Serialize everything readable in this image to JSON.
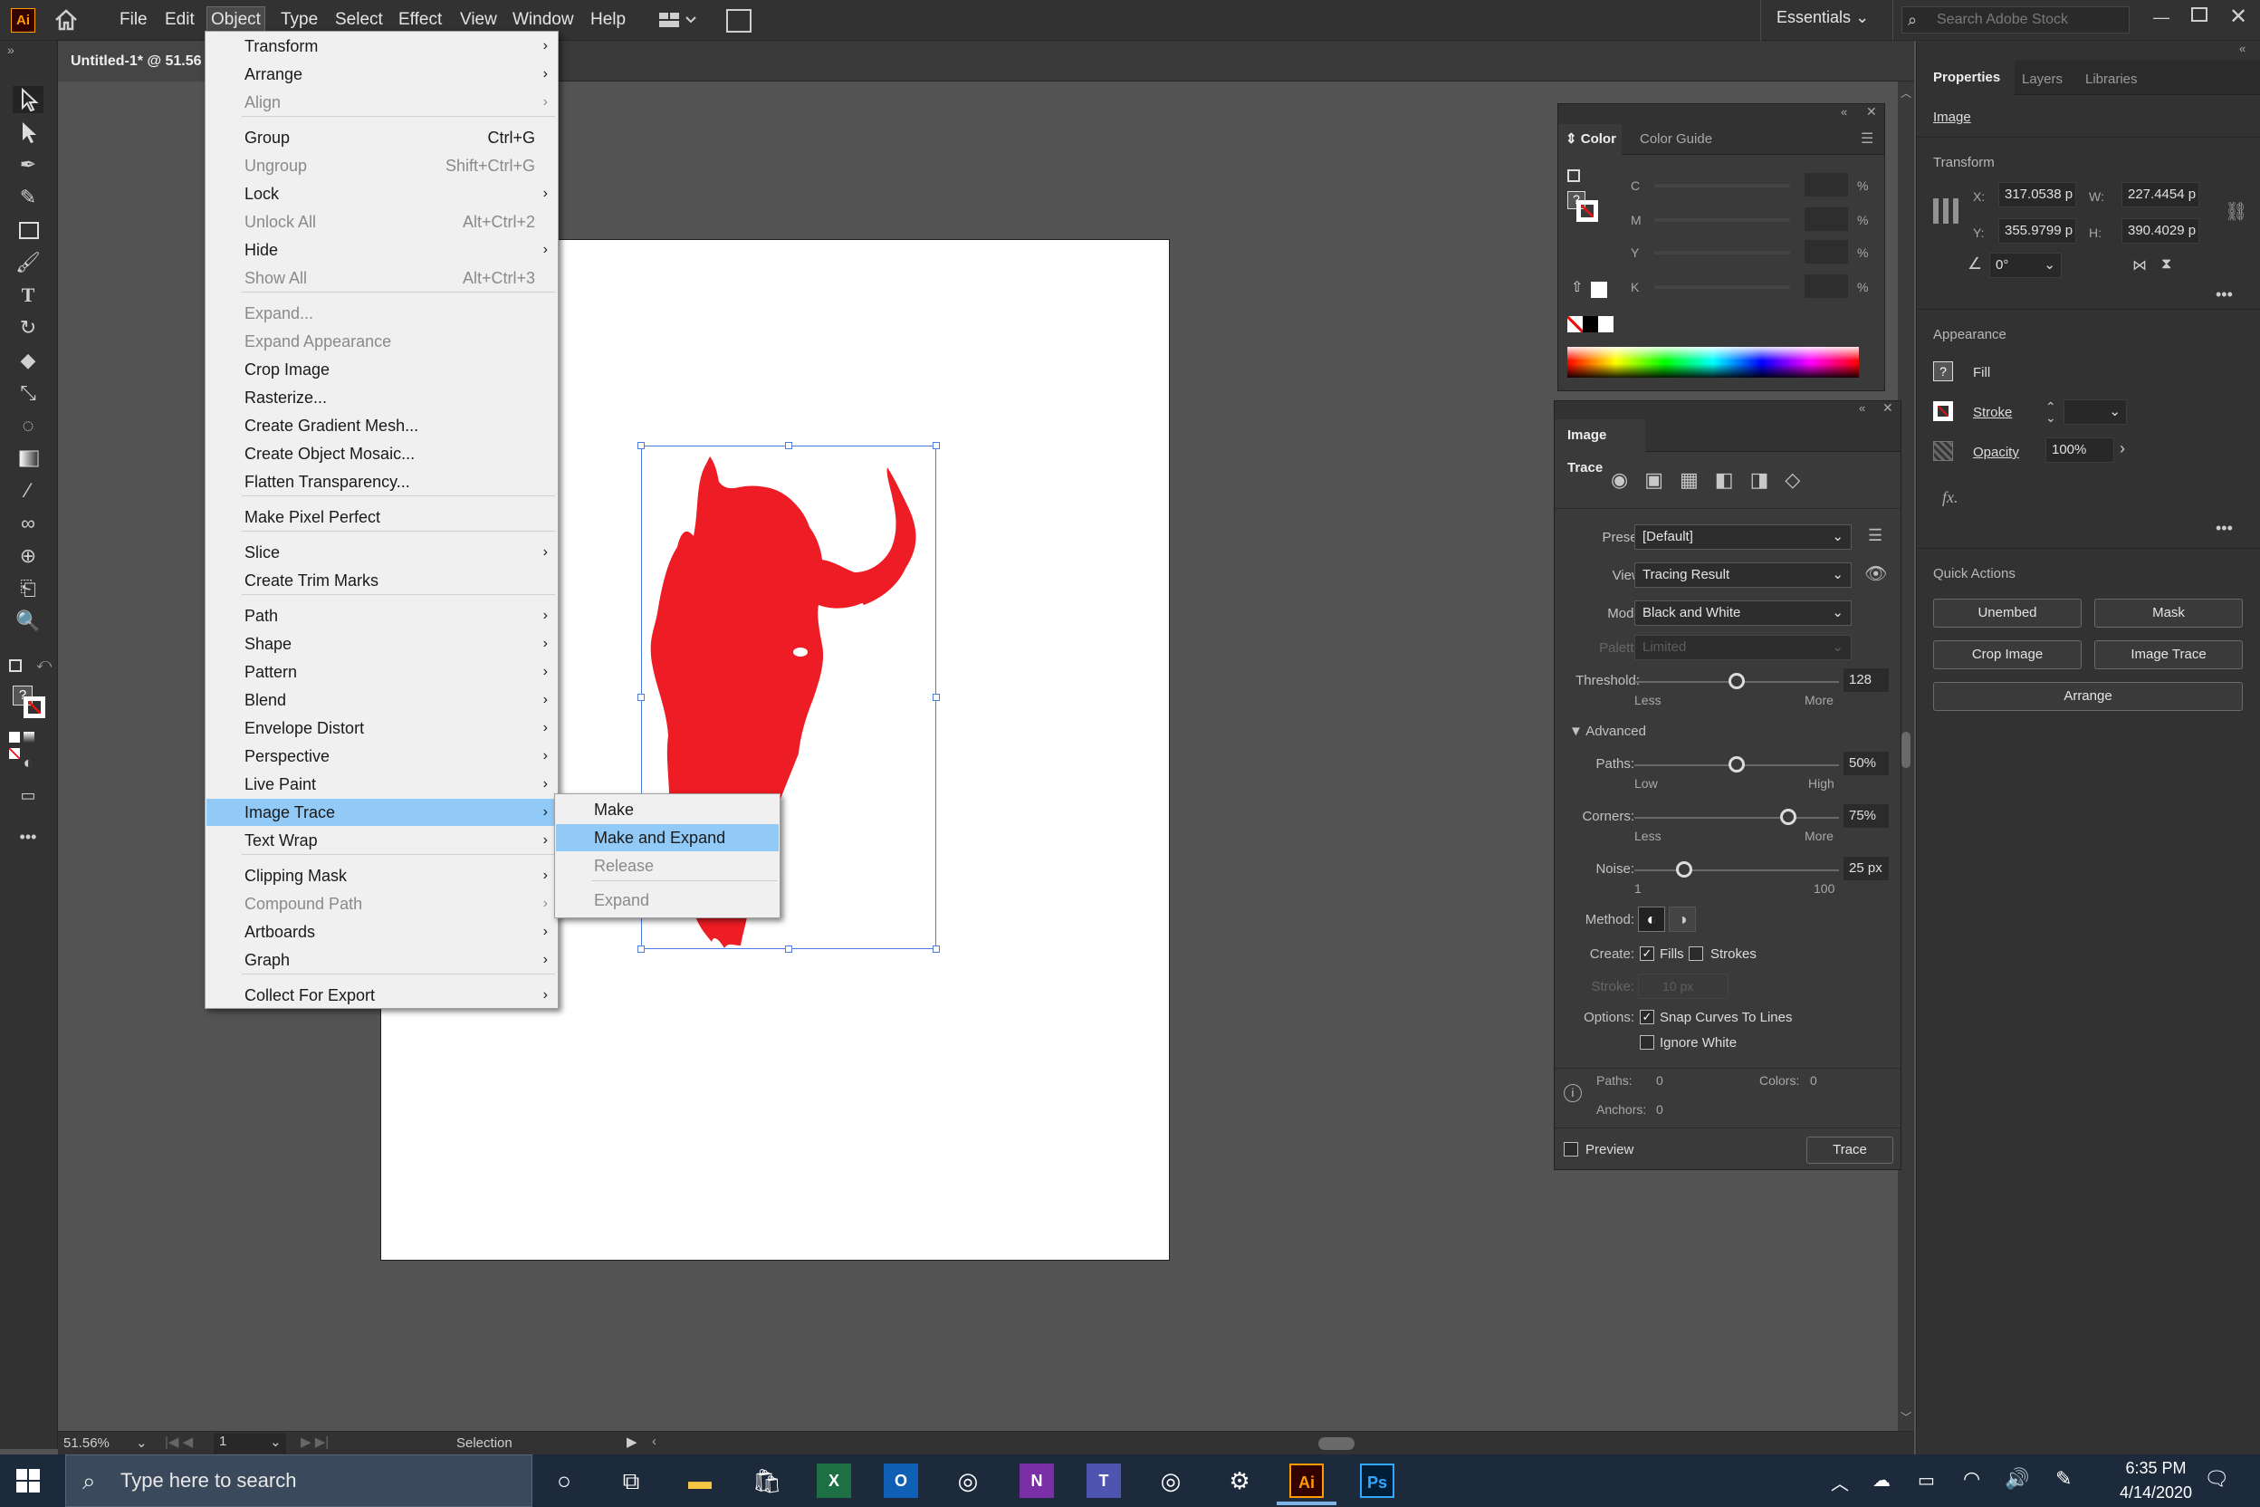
{
  "app": {
    "logo": "Ai",
    "document_tab": "Untitled-1* @ 51.56"
  },
  "menubar": {
    "items": [
      "File",
      "Edit",
      "Object",
      "Type",
      "Select",
      "Effect",
      "View",
      "Window",
      "Help"
    ],
    "workspace": "Essentials",
    "search_placeholder": "Search Adobe Stock"
  },
  "object_menu": [
    {
      "label": "Transform",
      "arrow": true
    },
    {
      "label": "Arrange",
      "arrow": true
    },
    {
      "label": "Align",
      "arrow": true,
      "disabled": true
    },
    {
      "label": "Group",
      "shortcut": "Ctrl+G"
    },
    {
      "label": "Ungroup",
      "shortcut": "Shift+Ctrl+G",
      "disabled": true
    },
    {
      "label": "Lock",
      "arrow": true
    },
    {
      "label": "Unlock All",
      "shortcut": "Alt+Ctrl+2",
      "disabled": true
    },
    {
      "label": "Hide",
      "arrow": true
    },
    {
      "label": "Show All",
      "shortcut": "Alt+Ctrl+3",
      "disabled": true
    },
    {
      "label": "Expand...",
      "disabled": true
    },
    {
      "label": "Expand Appearance",
      "disabled": true
    },
    {
      "label": "Crop Image"
    },
    {
      "label": "Rasterize..."
    },
    {
      "label": "Create Gradient Mesh..."
    },
    {
      "label": "Create Object Mosaic..."
    },
    {
      "label": "Flatten Transparency..."
    },
    {
      "label": "Make Pixel Perfect"
    },
    {
      "label": "Slice",
      "arrow": true
    },
    {
      "label": "Create Trim Marks"
    },
    {
      "label": "Path",
      "arrow": true
    },
    {
      "label": "Shape",
      "arrow": true
    },
    {
      "label": "Pattern",
      "arrow": true
    },
    {
      "label": "Blend",
      "arrow": true
    },
    {
      "label": "Envelope Distort",
      "arrow": true
    },
    {
      "label": "Perspective",
      "arrow": true
    },
    {
      "label": "Live Paint",
      "arrow": true
    },
    {
      "label": "Image Trace",
      "arrow": true,
      "highlighted": true
    },
    {
      "label": "Text Wrap",
      "arrow": true
    },
    {
      "label": "Clipping Mask",
      "arrow": true
    },
    {
      "label": "Compound Path",
      "arrow": true,
      "disabled": true
    },
    {
      "label": "Artboards",
      "arrow": true
    },
    {
      "label": "Graph",
      "arrow": true
    },
    {
      "label": "Collect For Export",
      "arrow": true
    }
  ],
  "image_trace_submenu": [
    {
      "label": "Make"
    },
    {
      "label": "Make and Expand",
      "highlighted": true
    },
    {
      "label": "Release",
      "disabled": true
    },
    {
      "label": "Expand",
      "disabled": true
    }
  ],
  "status": {
    "zoom": "51.56%",
    "artboard": "1",
    "tool": "Selection"
  },
  "color_panel": {
    "tabs": [
      "Color",
      "Color Guide"
    ],
    "channels": [
      "C",
      "M",
      "Y",
      "K"
    ],
    "unit": "%"
  },
  "trace_panel": {
    "title": "Image Trace",
    "preset_label": "Preset:",
    "preset": "[Default]",
    "view_label": "View:",
    "view": "Tracing Result",
    "mode_label": "Mode:",
    "mode": "Black and White",
    "palette_label": "Palette:",
    "palette": "Limited",
    "threshold_label": "Threshold:",
    "threshold": "128",
    "threshold_min": "Less",
    "threshold_max": "More",
    "threshold_value": 128,
    "advanced": "Advanced",
    "paths_label": "Paths:",
    "paths": "50%",
    "paths_min": "Low",
    "paths_max": "High",
    "paths_value": 50,
    "corners_label": "Corners:",
    "corners": "75%",
    "corners_min": "Less",
    "corners_max": "More",
    "corners_value": 75,
    "noise_label": "Noise:",
    "noise": "25 px",
    "noise_min": "1",
    "noise_max": "100",
    "noise_value": 25,
    "method_label": "Method:",
    "create_label": "Create:",
    "fills": "Fills",
    "strokes": "Strokes",
    "stroke_label": "Stroke:",
    "stroke_value": "10 px",
    "options_label": "Options:",
    "snap": "Snap Curves To Lines",
    "ignore_white": "Ignore White",
    "info_paths_label": "Paths:",
    "info_paths": "0",
    "info_colors_label": "Colors:",
    "info_colors": "0",
    "info_anchors_label": "Anchors:",
    "info_anchors": "0",
    "preview": "Preview",
    "trace_button": "Trace"
  },
  "properties": {
    "tabs": [
      "Properties",
      "Layers",
      "Libraries"
    ],
    "section": "Image",
    "transform": "Transform",
    "x_label": "X:",
    "x": "317.0538 p",
    "y_label": "Y:",
    "y": "355.9799 p",
    "w_label": "W:",
    "w": "227.4454 p",
    "h_label": "H:",
    "h": "390.4029 p",
    "angle": "0°",
    "appearance": "Appearance",
    "fill": "Fill",
    "stroke": "Stroke",
    "opacity_label": "Opacity",
    "opacity": "100%",
    "fx": "fx.",
    "quick_actions": "Quick Actions",
    "buttons": [
      "Unembed",
      "Mask",
      "Crop Image",
      "Image Trace",
      "Arrange"
    ]
  },
  "taskbar": {
    "search_placeholder": "Type here to search",
    "time": "6:35 PM",
    "date": "4/14/2020"
  },
  "colors": {
    "accent": "#91c9f7",
    "buffalo": "#ee1c24",
    "selection": "#4a7fe0"
  }
}
